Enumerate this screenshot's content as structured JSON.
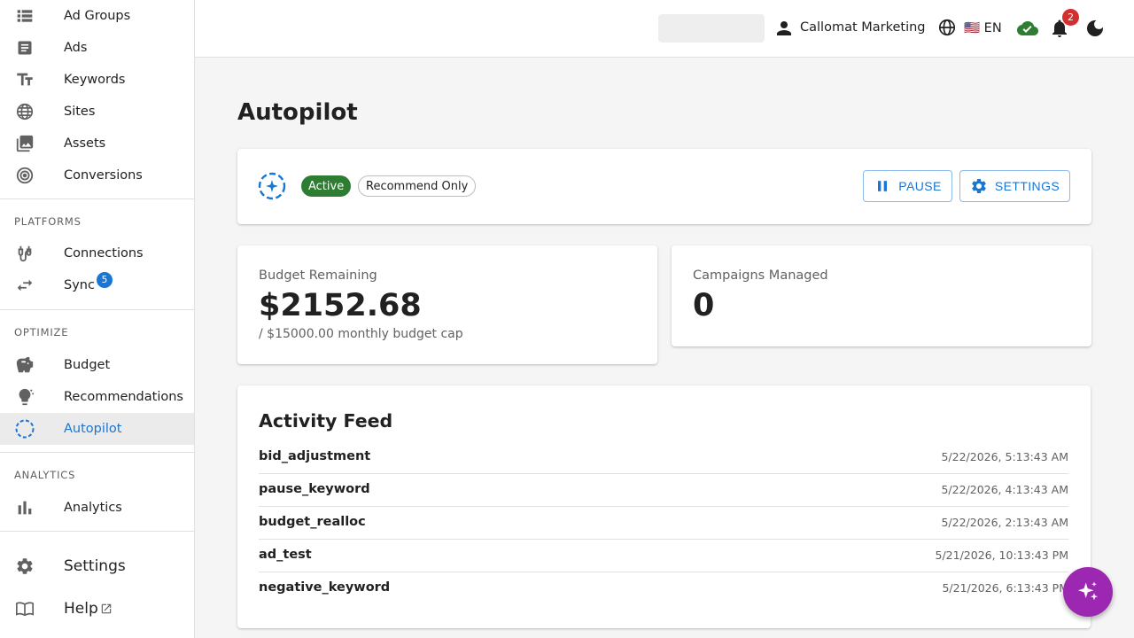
{
  "sidebar": {
    "items": {
      "ad_groups": "Ad Groups",
      "ads": "Ads",
      "keywords": "Keywords",
      "sites": "Sites",
      "assets": "Assets",
      "conversions": "Conversions",
      "connections": "Connections",
      "sync": "Sync",
      "budget": "Budget",
      "recommendations": "Recommendations",
      "autopilot": "Autopilot",
      "analytics": "Analytics",
      "settings": "Settings",
      "help": "Help"
    },
    "sections": {
      "platforms": "PLATFORMS",
      "optimize": "OPTIMIZE",
      "analytics": "ANALYTICS"
    },
    "sync_badge": "5",
    "active_item": "Autopilot"
  },
  "topbar": {
    "account_name": "Callomat Marketing",
    "language": "🇺🇸 EN",
    "notification_count": "2"
  },
  "page": {
    "title": "Autopilot"
  },
  "status_card": {
    "status_chip": "Active",
    "mode_chip": "Recommend Only",
    "pause_label": "PAUSE",
    "settings_label": "SETTINGS"
  },
  "stats": {
    "budget": {
      "label": "Budget Remaining",
      "value": "$2152.68",
      "sub": "/ $15000.00 monthly budget cap"
    },
    "campaigns": {
      "label": "Campaigns Managed",
      "value": "0"
    }
  },
  "activity": {
    "title": "Activity Feed",
    "rows": [
      {
        "action": "bid_adjustment",
        "time": "5/22/2026, 5:13:43 AM"
      },
      {
        "action": "pause_keyword",
        "time": "5/22/2026, 4:13:43 AM"
      },
      {
        "action": "budget_realloc",
        "time": "5/22/2026, 2:13:43 AM"
      },
      {
        "action": "ad_test",
        "time": "5/21/2026, 10:13:43 PM"
      },
      {
        "action": "negative_keyword",
        "time": "5/21/2026, 6:13:43 PM"
      }
    ]
  },
  "colors": {
    "primary": "#1976d2",
    "success": "#2e7d32",
    "fab": "#9c27b0",
    "badge_red": "#d32f2f",
    "cloud_green": "#2e7d32"
  },
  "icons": {
    "ad_groups": "list-icon",
    "ads": "article-icon",
    "keywords": "text-fields-icon",
    "sites": "globe-icon",
    "assets": "image-icon",
    "conversions": "target-icon",
    "connections": "plug-icon",
    "sync": "swap-arrows-icon",
    "budget": "piggy-bank-icon",
    "recommendations": "lightbulb-icon",
    "autopilot": "autopilot-icon",
    "analytics": "bar-chart-icon",
    "settings": "gear-icon",
    "help": "book-icon",
    "fab": "sparkle-icon"
  }
}
